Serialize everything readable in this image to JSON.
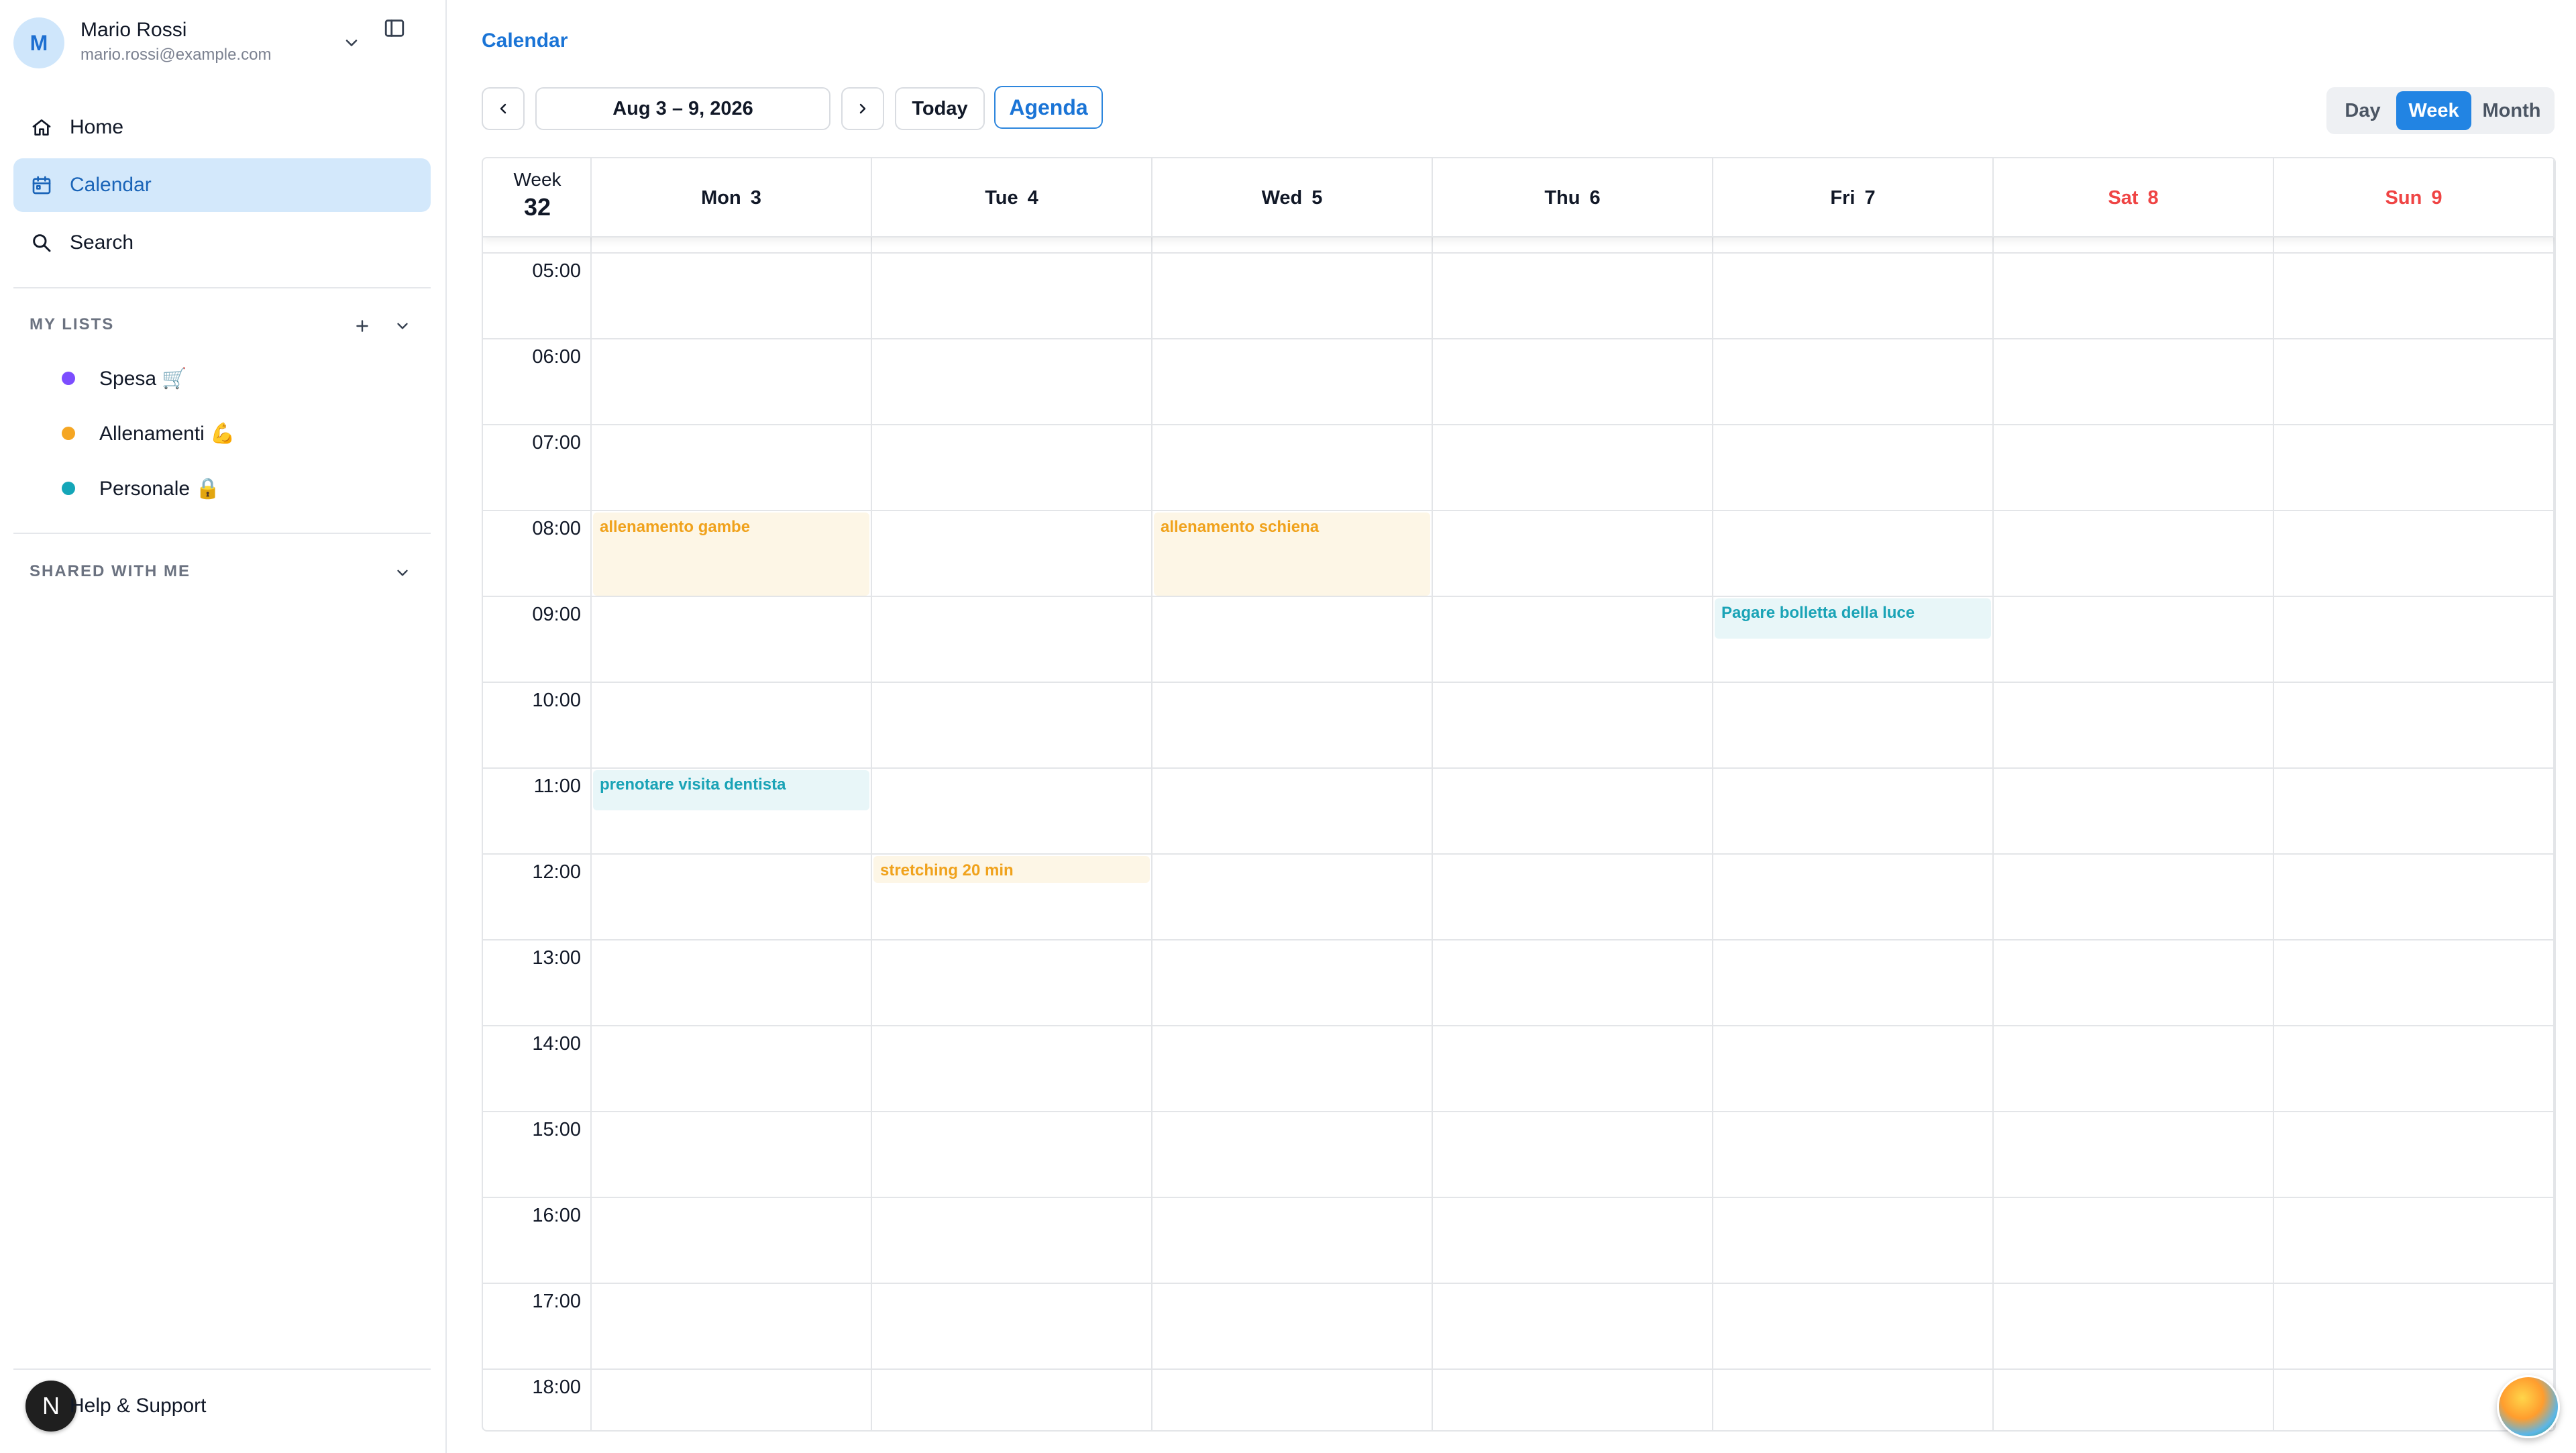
{
  "user": {
    "initial": "M",
    "name": "Mario Rossi",
    "email": "mario.rossi@example.com"
  },
  "nav": [
    {
      "label": "Home",
      "icon": "home-icon",
      "active": false
    },
    {
      "label": "Calendar",
      "icon": "calendar-icon",
      "active": true
    },
    {
      "label": "Search",
      "icon": "search-icon",
      "active": false
    }
  ],
  "my_lists": {
    "title": "MY LISTS",
    "items": [
      {
        "label": "Spesa 🛒",
        "color": "#7c4dff"
      },
      {
        "label": "Allenamenti 💪",
        "color": "#f5a623"
      },
      {
        "label": "Personale 🔒",
        "color": "#14a6b8"
      }
    ]
  },
  "shared": {
    "title": "SHARED WITH ME"
  },
  "help": {
    "badge": "N",
    "label": "Help & Support"
  },
  "breadcrumb": "Calendar",
  "toolbar": {
    "range": "Aug 3 – 9, 2026",
    "today": "Today",
    "agenda": "Agenda"
  },
  "views": [
    "Day",
    "Week",
    "Month"
  ],
  "active_view": "Week",
  "week": {
    "label": "Week",
    "number": "32"
  },
  "days": [
    {
      "name": "Mon",
      "num": "3",
      "weekend": false
    },
    {
      "name": "Tue",
      "num": "4",
      "weekend": false
    },
    {
      "name": "Wed",
      "num": "5",
      "weekend": false
    },
    {
      "name": "Thu",
      "num": "6",
      "weekend": false
    },
    {
      "name": "Fri",
      "num": "7",
      "weekend": false
    },
    {
      "name": "Sat",
      "num": "8",
      "weekend": true
    },
    {
      "name": "Sun",
      "num": "9",
      "weekend": true
    }
  ],
  "hours": [
    "05:00",
    "06:00",
    "07:00",
    "08:00",
    "09:00",
    "10:00",
    "11:00",
    "12:00",
    "13:00",
    "14:00",
    "15:00",
    "16:00",
    "17:00",
    "18:00"
  ],
  "events": [
    {
      "title": "allenamento gambe",
      "day": 0,
      "start": 8.0,
      "end": 9.0,
      "color": "orange"
    },
    {
      "title": "allenamento schiena",
      "day": 2,
      "start": 8.0,
      "end": 9.0,
      "color": "orange"
    },
    {
      "title": "Pagare bolletta della luce",
      "day": 4,
      "start": 9.0,
      "end": 9.5,
      "color": "teal"
    },
    {
      "title": "prenotare visita dentista",
      "day": 0,
      "start": 11.0,
      "end": 11.5,
      "color": "teal"
    },
    {
      "title": "stretching 20 min",
      "day": 1,
      "start": 12.0,
      "end": 12.33,
      "color": "orange"
    }
  ]
}
